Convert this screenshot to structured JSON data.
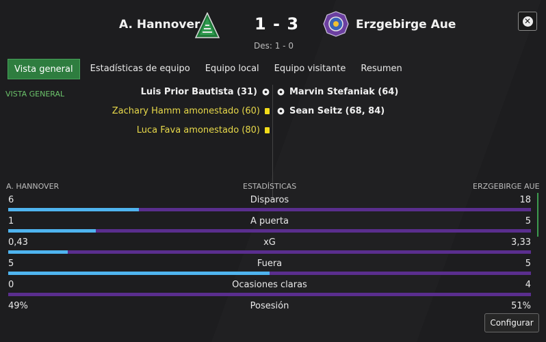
{
  "header": {
    "home_team": "A. Hannover",
    "away_team": "Erzgebirge Aue",
    "score": "1 - 3",
    "halftime": "Des: 1 - 0",
    "close_icon": "close-icon"
  },
  "tabs": [
    {
      "label": "Vista general",
      "active": true
    },
    {
      "label": "Estadísticas de equipo"
    },
    {
      "label": "Equipo local"
    },
    {
      "label": "Equipo visitante"
    },
    {
      "label": "Resumen"
    }
  ],
  "section_label": "VISTA GENERAL",
  "events": {
    "home": [
      {
        "text": "Luis Prior Bautista (31)",
        "type": "goal"
      },
      {
        "text": "Zachary Hamm amonestado (60)",
        "type": "yellow-card"
      },
      {
        "text": "Luca Fava amonestado (80)",
        "type": "yellow-card"
      }
    ],
    "away": [
      {
        "text": "Marvin Stefaniak (64)",
        "type": "goal"
      },
      {
        "text": "Sean Seitz (68, 84)",
        "type": "goal"
      }
    ]
  },
  "stats": {
    "home_label": "A. HANNOVER",
    "title": "ESTADÍSTICAS",
    "away_label": "ERZGEBIRGE AUE",
    "rows": [
      {
        "name": "Disparos",
        "home": "6",
        "away": "18",
        "home_share": 0.25
      },
      {
        "name": "A puerta",
        "home": "1",
        "away": "5",
        "home_share": 0.167
      },
      {
        "name": "xG",
        "home": "0,43",
        "away": "3,33",
        "home_share": 0.114
      },
      {
        "name": "Fuera",
        "home": "5",
        "away": "5",
        "home_share": 0.5
      },
      {
        "name": "Ocasiones claras",
        "home": "0",
        "away": "4",
        "home_share": 0.0
      },
      {
        "name": "Posesión",
        "home": "49%",
        "away": "51%",
        "home_share": 0.49
      }
    ]
  },
  "config_button": "Configurar",
  "colors": {
    "active_tab": "#2e7d3f",
    "home_bar": "#4fb4ef",
    "away_bar": "#5a2e8e",
    "yellow_event": "#e8d94a",
    "section_label": "#6cc36b"
  }
}
